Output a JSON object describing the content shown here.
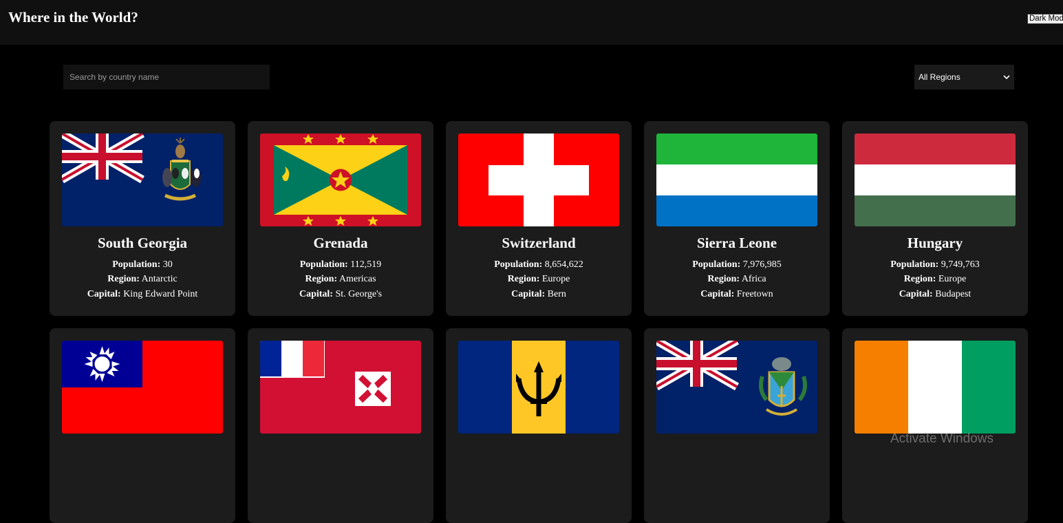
{
  "header": {
    "title": "Where in the World?",
    "mode_button": "Dark Mode"
  },
  "search": {
    "placeholder": "Search by country name",
    "value": ""
  },
  "filter": {
    "selected": "All Regions"
  },
  "labels": {
    "population": "Population:",
    "region": "Region:",
    "capital": "Capital:"
  },
  "countries": [
    {
      "name": "South Georgia",
      "population": "30",
      "region": "Antarctic",
      "capital": "King Edward Point",
      "flag": "south-georgia-flag"
    },
    {
      "name": "Grenada",
      "population": "112,519",
      "region": "Americas",
      "capital": "St. George's",
      "flag": "grenada-flag"
    },
    {
      "name": "Switzerland",
      "population": "8,654,622",
      "region": "Europe",
      "capital": "Bern",
      "flag": "switzerland-flag"
    },
    {
      "name": "Sierra Leone",
      "population": "7,976,985",
      "region": "Africa",
      "capital": "Freetown",
      "flag": "sierra-leone-flag"
    },
    {
      "name": "Hungary",
      "population": "9,749,763",
      "region": "Europe",
      "capital": "Budapest",
      "flag": "hungary-flag"
    },
    {
      "flag": "taiwan-flag"
    },
    {
      "flag": "wallis-and-futuna-flag"
    },
    {
      "flag": "barbados-flag"
    },
    {
      "flag": "pitcairn-islands-flag"
    },
    {
      "flag": "ivory-coast-flag"
    }
  ],
  "watermark": "Activate Windows"
}
